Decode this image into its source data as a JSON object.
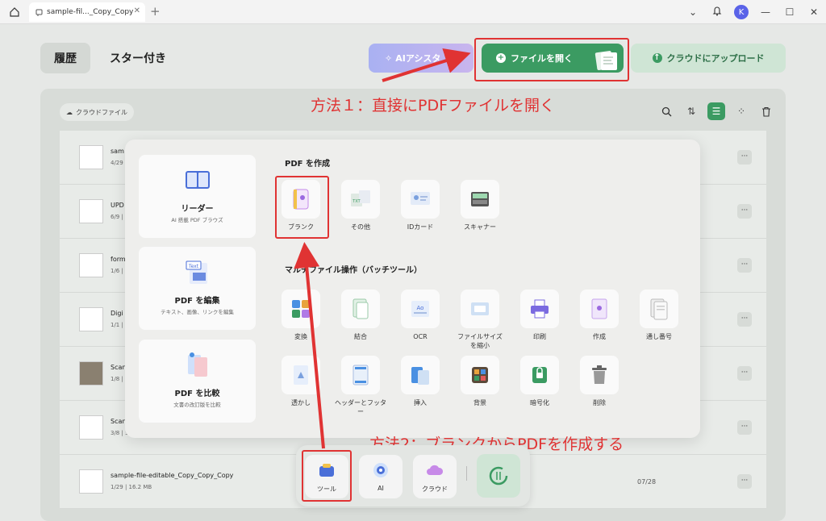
{
  "titlebar": {
    "tab_title": "sample-fil..._Copy_Copy",
    "new_tab": "+",
    "avatar_letter": "K"
  },
  "header": {
    "history_tab": "履歴",
    "starred_tab": "スター付き",
    "ai_button": "AIアシスタ",
    "open_file_button": "ファイルを開く",
    "cloud_upload_button": "クラウドにアップロード"
  },
  "panel": {
    "cloud_chip": "クラウドファイル"
  },
  "annotations": {
    "method1": "方法１：直接にPDFファイルを開く",
    "method2": "方法2：ブランクからPDFを作成する"
  },
  "files": [
    {
      "name": "sam",
      "meta": "4/29",
      "date": ""
    },
    {
      "name": "UPD",
      "meta": "6/9 |",
      "date": ""
    },
    {
      "name": "form",
      "meta": "1/6 |",
      "date": ""
    },
    {
      "name": "Digi",
      "meta": "1/1 |",
      "date": ""
    },
    {
      "name": "Scan",
      "meta": "1/8 |",
      "date": ""
    },
    {
      "name": "Scan",
      "meta": "3/8 | 57",
      "date": ""
    },
    {
      "name": "sample-file-editable_Copy_Copy_Copy",
      "meta": "1/29 | 16.2 MB",
      "date": "07/28"
    }
  ],
  "popup": {
    "cards": [
      {
        "title": "リーダー",
        "sub": "AI 搭載 PDF ブラウズ",
        "icon": "book-icon"
      },
      {
        "title": "PDF を編集",
        "sub": "テキスト、画像、リンクを編集",
        "icon": "edit-text-icon"
      },
      {
        "title": "PDF を比較",
        "sub": "文書の改訂版を比較",
        "icon": "compare-icon"
      }
    ],
    "create_section": "PDF を作成",
    "create_tools": [
      {
        "label": "ブランク",
        "icon": "blank-doc-icon"
      },
      {
        "label": "その他",
        "icon": "other-files-icon"
      },
      {
        "label": "IDカード",
        "icon": "id-card-icon"
      },
      {
        "label": "スキャナー",
        "icon": "scanner-icon"
      }
    ],
    "batch_section": "マルチファイル操作（バッチツール）",
    "batch_tools_row1": [
      {
        "label": "変換",
        "icon": "convert-icon"
      },
      {
        "label": "結合",
        "icon": "combine-icon"
      },
      {
        "label": "OCR",
        "icon": "ocr-icon"
      },
      {
        "label": "ファイルサイズ\nを縮小",
        "icon": "compress-icon"
      },
      {
        "label": "印刷",
        "icon": "print-icon"
      },
      {
        "label": "作成",
        "icon": "create-icon"
      },
      {
        "label": "通し番号",
        "icon": "bates-number-icon"
      }
    ],
    "batch_tools_row2": [
      {
        "label": "透かし",
        "icon": "watermark-icon"
      },
      {
        "label": "ヘッダーとフッター",
        "icon": "header-footer-icon"
      },
      {
        "label": "挿入",
        "icon": "insert-icon"
      },
      {
        "label": "背景",
        "icon": "background-icon"
      },
      {
        "label": "暗号化",
        "icon": "encrypt-icon"
      },
      {
        "label": "削除",
        "icon": "delete-icon"
      }
    ]
  },
  "dock": {
    "tools": "ツール",
    "ai": "AI",
    "cloud": "クラウド"
  },
  "colors": {
    "accent_green": "#3b9b62",
    "annotation_red": "#e03333",
    "ai_purple": "#a9b1f2"
  }
}
